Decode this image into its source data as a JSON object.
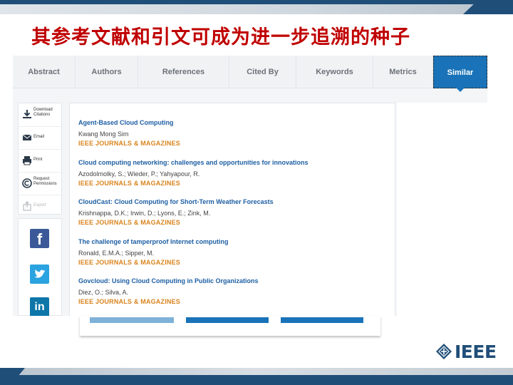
{
  "slide": {
    "title": "其参考文献和引文可成为进一步追溯的种子"
  },
  "tabs": [
    {
      "label": "Abstract"
    },
    {
      "label": "Authors"
    },
    {
      "label": "References"
    },
    {
      "label": "Cited By"
    },
    {
      "label": "Keywords"
    },
    {
      "label": "Metrics"
    },
    {
      "label": "Similar",
      "active": true
    }
  ],
  "sidebar": {
    "items": [
      {
        "label": "Download Citations",
        "icon": "download-icon"
      },
      {
        "label": "Email",
        "icon": "email-icon"
      },
      {
        "label": "Print",
        "icon": "print-icon"
      },
      {
        "label": "Request Permissions",
        "icon": "copyright-icon"
      },
      {
        "label": "Export",
        "icon": "export-icon",
        "disabled": true
      }
    ]
  },
  "social": {
    "facebook": "f",
    "twitter": "t",
    "linkedin": "in"
  },
  "articles": [
    {
      "title": "Agent-Based Cloud Computing",
      "authors": "Kwang Mong Sim",
      "publication": "IEEE JOURNALS & MAGAZINES"
    },
    {
      "title": "Cloud computing networking: challenges and opportunities for innovations",
      "authors": "Azodolmolky, S.; Wieder, P.; Yahyapour, R.",
      "publication": "IEEE JOURNALS & MAGAZINES"
    },
    {
      "title": "CloudCast: Cloud Computing for Short-Term Weather Forecasts",
      "authors": "Krishnappa, D.K.; Irwin, D.; Lyons, E.; Zink, M.",
      "publication": "IEEE JOURNALS & MAGAZINES"
    },
    {
      "title": "The challenge of tamperproof Internet computing",
      "authors": "Ronald, E.M.A.; Sipper, M.",
      "publication": "IEEE JOURNALS & MAGAZINES"
    },
    {
      "title": "Govcloud: Using Cloud Computing in Public Organizations",
      "authors": "Diez, O.; Silva, A.",
      "publication": "IEEE JOURNALS & MAGAZINES"
    }
  ],
  "logo": {
    "text": "IEEE"
  },
  "colors": {
    "title_red": "#c00000",
    "ieee_blue": "#1f4e79",
    "tab_active": "#1a73b8",
    "link_blue": "#1e5fa3",
    "publication_orange": "#d9831c"
  }
}
